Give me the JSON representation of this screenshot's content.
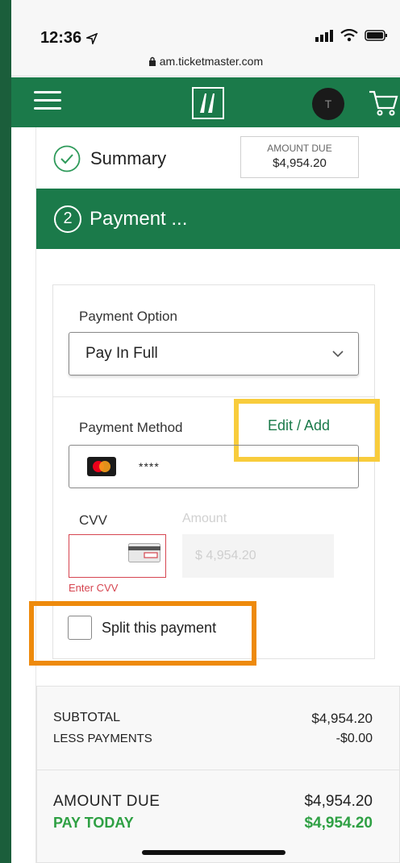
{
  "status_bar": {
    "time": "12:36",
    "url": "am.ticketmaster.com"
  },
  "header": {
    "avatar_initial": "T"
  },
  "summary": {
    "label": "Summary",
    "amount_due_label": "AMOUNT DUE",
    "amount_due_value": "$4,954.20"
  },
  "payment": {
    "step_number": "2",
    "title": "Payment ...",
    "option_label": "Payment Option",
    "option_selected": "Pay In Full",
    "method_label": "Payment Method",
    "edit_link": "Edit / Add",
    "card_masked": "****",
    "cvv_label": "CVV",
    "cvv_error": "Enter CVV",
    "amount_label": "Amount",
    "amount_placeholder": "$ 4,954.20",
    "split_label": "Split this payment"
  },
  "totals": {
    "subtotal_label": "SUBTOTAL",
    "subtotal_value": "$4,954.20",
    "less_payments_label": "LESS PAYMENTS",
    "less_payments_value": "-$0.00",
    "amount_due_label": "AMOUNT DUE",
    "amount_due_value": "$4,954.20",
    "pay_today_label": "PAY TODAY",
    "pay_today_value": "$4,954.20"
  },
  "colors": {
    "brand_green": "#1b7a4a",
    "error_red": "#d64550",
    "highlight_yellow": "#f8cc3c",
    "highlight_orange": "#ee8a0c"
  }
}
